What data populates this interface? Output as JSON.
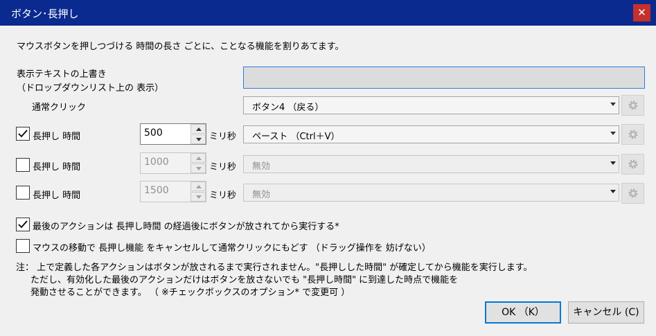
{
  "window": {
    "title": "ボタン･長押し",
    "close_glyph": "✕"
  },
  "description": "マウスボタンを押しつづける 時間の長さ ごとに、ことなる機能を割りあてます。",
  "override": {
    "label_line1": "表示テキストの上書き",
    "label_line2": "（ドロップダウンリスト上の 表示）",
    "value": ""
  },
  "normal_click": {
    "label": "通常クリック",
    "action": "ボタン4 （戻る）"
  },
  "long_press_rows": [
    {
      "label": "長押し 時間",
      "checked": true,
      "value": "500",
      "unit": "ミリ秒",
      "action": "ペースト （Ctrl＋V）",
      "enabled": true
    },
    {
      "label": "長押し 時間",
      "checked": false,
      "value": "1000",
      "unit": "ミリ秒",
      "action": "無効",
      "enabled": false
    },
    {
      "label": "長押し 時間",
      "checked": false,
      "value": "1500",
      "unit": "ミリ秒",
      "action": "無効",
      "enabled": false
    }
  ],
  "options": {
    "execute_after_release": {
      "label": "最後のアクションは 長押し時間 の経過後にボタンが放されてから実行する*",
      "checked": true
    },
    "cancel_on_move": {
      "label": "マウスの移動で 長押し機能 をキャンセルして通常クリックにもどす （ドラッグ操作を 妨げない）",
      "checked": false
    }
  },
  "note": {
    "line1": "注： 上で定義した各アクションはボタンが放されるまで実行されません。\"長押しした時間\" が確定してから機能を実行します。",
    "line2": "ただし、有効化した最後のアクションだけはボタンを放さないでも \"長押し時間\" に到達した時点で機能を",
    "line3": "発動させることができます。 （ ※チェックボックスのオプション* で変更可 ）"
  },
  "buttons": {
    "ok": "OK （K）",
    "cancel": "キャンセル (C)"
  },
  "colors": {
    "titlebar": "#0a2a8f",
    "close": "#c4302b",
    "focus": "#0078d7"
  },
  "icons": {
    "settings": "gear-icon",
    "checkmark": "checkmark-icon"
  }
}
